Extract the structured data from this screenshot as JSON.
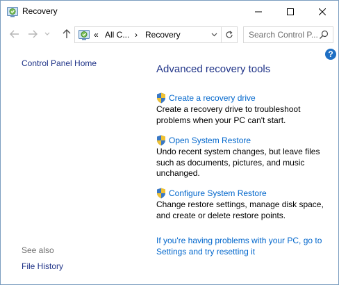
{
  "window": {
    "title": "Recovery",
    "controls": [
      "minimize",
      "maximize",
      "close"
    ]
  },
  "address": {
    "overflow": "«",
    "segments": [
      "All C...",
      "Recovery"
    ],
    "separator": "›"
  },
  "search": {
    "placeholder": "Search Control P..."
  },
  "help": {
    "glyph": "?"
  },
  "sidebar": {
    "home_link": "Control Panel Home",
    "see_also_label": "See also",
    "see_also_links": [
      "File History"
    ]
  },
  "main": {
    "heading": "Advanced recovery tools",
    "tasks": [
      {
        "label": "Create a recovery drive",
        "description": "Create a recovery drive to troubleshoot problems when your PC can't start."
      },
      {
        "label": "Open System Restore",
        "description": "Undo recent system changes, but leave files such as documents, pictures, and music unchanged."
      },
      {
        "label": "Configure System Restore",
        "description": "Change restore settings, manage disk space, and create or delete restore points."
      }
    ],
    "reset_link": "If you're having problems with your PC, go to Settings and try resetting it"
  },
  "colors": {
    "link": "#0066cc",
    "heading": "#1e3287",
    "help_blue": "#1e6fc4",
    "border": "#7a9cbf"
  },
  "icons": {
    "app": "recovery-icon",
    "task": "uac-shield-icon"
  }
}
